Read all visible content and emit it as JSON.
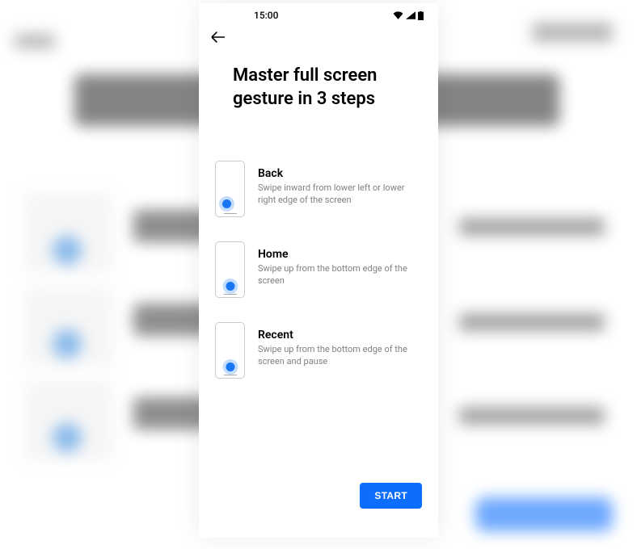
{
  "status_bar": {
    "time": "15:00"
  },
  "title": "Master full screen gesture in 3 steps",
  "steps": [
    {
      "name": "Back",
      "description": "Swipe inward from lower left or  lower right edge of the screen"
    },
    {
      "name": "Home",
      "description": "Swipe up from the bottom edge of the screen"
    },
    {
      "name": "Recent",
      "description": "Swipe up from the bottom edge of the screen and pause"
    }
  ],
  "footer": {
    "start_label": "START"
  }
}
